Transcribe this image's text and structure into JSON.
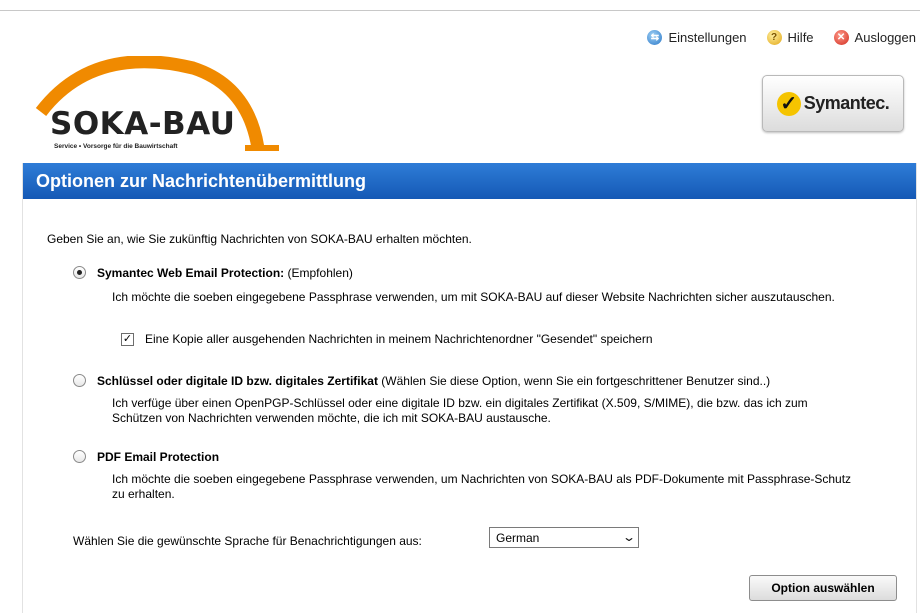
{
  "topnav": {
    "settings": "Einstellungen",
    "help": "Hilfe",
    "logout": "Ausloggen"
  },
  "logo": {
    "name": "SOKA-BAU",
    "tagline": "Service • Vorsorge für die Bauwirtschaft",
    "colors": {
      "arc": "#f08a00",
      "text": "#222222"
    }
  },
  "badge": {
    "name": "Symantec."
  },
  "panel": {
    "title": "Optionen zur Nachrichtenübermittlung",
    "intro": "Geben Sie an, wie Sie zukünftig Nachrichten von SOKA-BAU erhalten möchten.",
    "options": [
      {
        "label": "Symantec Web Email Protection:",
        "note": "(Empfohlen)",
        "description": "Ich möchte die soeben eingegebene Passphrase verwenden, um mit SOKA-BAU auf dieser Website Nachrichten sicher auszutauschen.",
        "checked": true,
        "copy_option": {
          "label": "Eine Kopie aller ausgehenden Nachrichten in meinem Nachrichtenordner \"Gesendet\" speichern",
          "checked": true
        }
      },
      {
        "label": "Schlüssel oder digitale ID bzw. digitales Zertifikat",
        "note": "(Wählen Sie diese Option, wenn Sie ein fortgeschrittener Benutzer sind..)",
        "description": "Ich verfüge über einen OpenPGP-Schlüssel oder eine digitale ID bzw. ein digitales Zertifikat (X.509, S/MIME), die bzw. das ich zum Schützen von Nachrichten verwenden möchte, die ich mit SOKA-BAU austausche.",
        "checked": false
      },
      {
        "label": "PDF Email Protection",
        "note": "",
        "description": "Ich möchte die soeben eingegebene Passphrase verwenden, um Nachrichten von SOKA-BAU als PDF-Dokumente mit Passphrase-Schutz zu erhalten.",
        "checked": false
      }
    ],
    "language": {
      "label": "Wählen Sie die gewünschte Sprache für Benachrichtigungen aus:",
      "selected": "German"
    },
    "submit": "Option auswählen"
  },
  "colors": {
    "titlebar": "#1f6cc7",
    "accent_orange": "#f08a00",
    "symantec_yellow": "#f5c400"
  },
  "icons": {
    "settings": "settings-icon",
    "help": "help-icon",
    "logout": "logout-icon",
    "dropdown": "chevron-down-icon",
    "checkmark": "checkmark-icon"
  }
}
